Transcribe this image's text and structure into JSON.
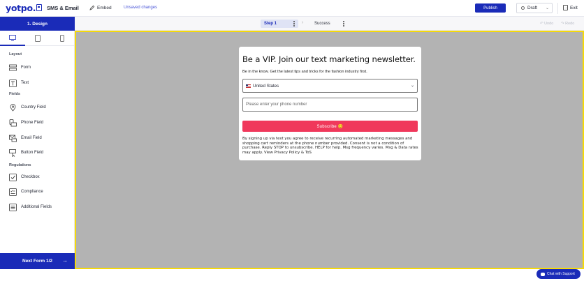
{
  "header": {
    "logo": "yotpo.",
    "app_name": "SMS & Email",
    "embed_label": "Embed",
    "unsaved": "Unsaved changes",
    "publish_label": "Publish",
    "status": "Draft",
    "exit_label": "Exit"
  },
  "steps": {
    "design_tab": "1. Design",
    "step1": "Step 1",
    "step2": "Success",
    "undo": "Undo",
    "redo": "Redo"
  },
  "sidebar": {
    "layout_label": "Layout",
    "fields_label": "Fields",
    "regulations_label": "Regulations",
    "layout_items": [
      {
        "label": "Form",
        "icon": "form-icon"
      },
      {
        "label": "Text",
        "icon": "text-icon"
      }
    ],
    "field_items": [
      {
        "label": "Country Field",
        "icon": "location-pin-icon"
      },
      {
        "label": "Phone Field",
        "icon": "phone-field-icon"
      },
      {
        "label": "Email Field",
        "icon": "email-field-icon"
      },
      {
        "label": "Button Field",
        "icon": "button-field-icon"
      }
    ],
    "regulation_items": [
      {
        "label": "Checkbox",
        "icon": "checkbox-icon"
      },
      {
        "label": "Compliance",
        "icon": "compliance-icon"
      },
      {
        "label": "Additional Fields",
        "icon": "additional-fields-icon"
      }
    ],
    "next_label": "Next Form 1/2"
  },
  "form": {
    "title": "Be a VIP. Join our text marketing newsletter.",
    "subtitle": "Be in the know. Get the latest tips and tricks for the fashion industry first.",
    "country_value": "United States",
    "phone_placeholder": "Please enter your phone number",
    "subscribe_label": "Subscribe 😊",
    "disclaimer": "By signing up via text you agree to receive recurring automated marketing messages and shopping cart reminders at the phone number provided. Consent is not a condition of purchase. Reply STOP to unsubscribe. HELP for help. Msg frequency varies. Msg & Data rates may apply. View Privacy Policy & ToS"
  },
  "support": {
    "chat_label": "Chat with Support"
  },
  "colors": {
    "brand": "#1a2bb8",
    "subscribe": "#f0385b",
    "canvas_border": "#f5d90a",
    "canvas_bg": "#b3b3b3"
  }
}
